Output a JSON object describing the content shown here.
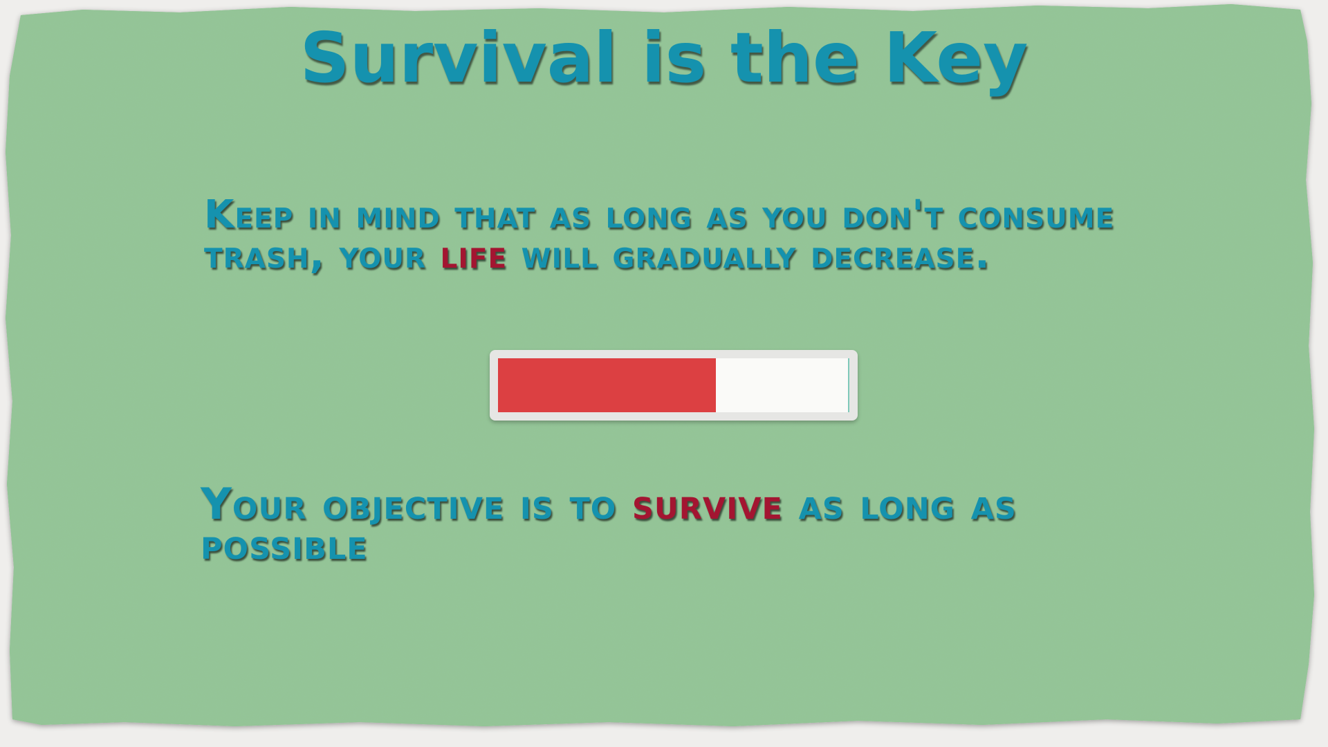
{
  "screen": {
    "title": "Survival is the Key",
    "intro": {
      "before": "Keep in mind that as long as you don't consume trash, your ",
      "highlight": "life",
      "after": " will gradually decrease."
    },
    "objective": {
      "before": "Your objective is to ",
      "highlight": "survive",
      "after": " as long as possible"
    },
    "life_bar": {
      "fill_fraction": 0.62,
      "fill_color": "#dc4042",
      "empty_color": "#fafaf8"
    }
  },
  "colors": {
    "paper": "#93c596",
    "text": "#1592ae",
    "highlight": "#a31531"
  }
}
